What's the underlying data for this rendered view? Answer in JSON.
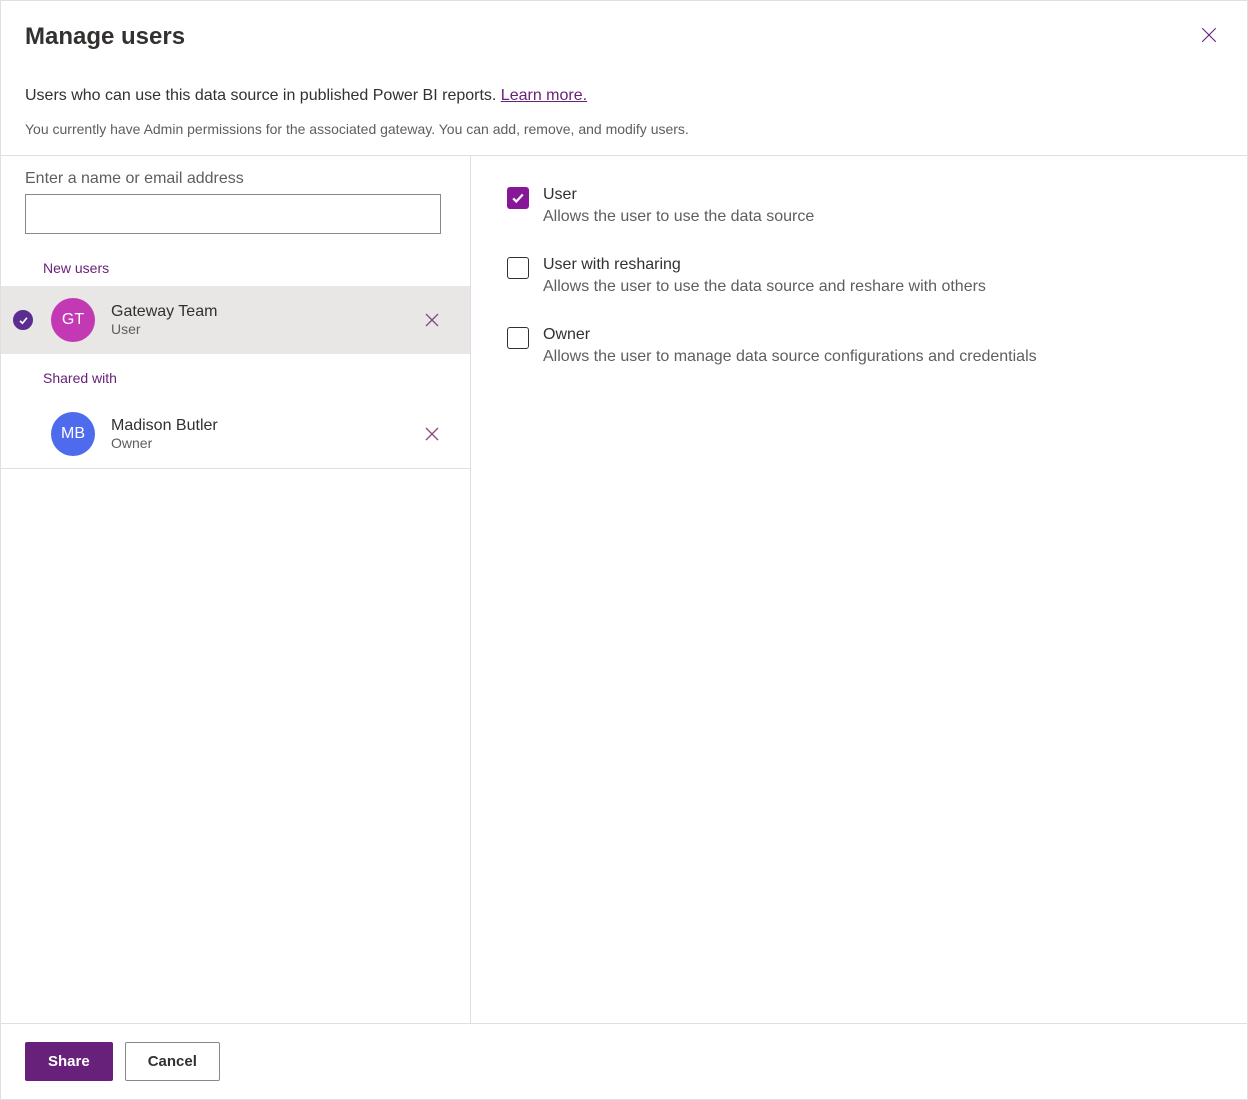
{
  "header": {
    "title": "Manage users",
    "description": "Users who can use this data source in published Power BI reports. ",
    "learn_more": "Learn more.",
    "permissions_note": "You currently have Admin permissions for the associated gateway. You can add, remove, and modify users."
  },
  "input": {
    "label": "Enter a name or email address",
    "value": ""
  },
  "sections": {
    "new_users": "New users",
    "shared_with": "Shared with"
  },
  "users": {
    "new": [
      {
        "initials": "GT",
        "name": "Gateway Team",
        "role": "User",
        "avatar_color": "pink",
        "selected": true
      }
    ],
    "shared": [
      {
        "initials": "MB",
        "name": "Madison Butler",
        "role": "Owner",
        "avatar_color": "blue",
        "selected": false
      }
    ]
  },
  "permissions": [
    {
      "title": "User",
      "description": "Allows the user to use the data source",
      "checked": true
    },
    {
      "title": "User with resharing",
      "description": "Allows the user to use the data source and reshare with others",
      "checked": false
    },
    {
      "title": "Owner",
      "description": "Allows the user to manage data source configurations and credentials",
      "checked": false
    }
  ],
  "footer": {
    "share": "Share",
    "cancel": "Cancel"
  }
}
